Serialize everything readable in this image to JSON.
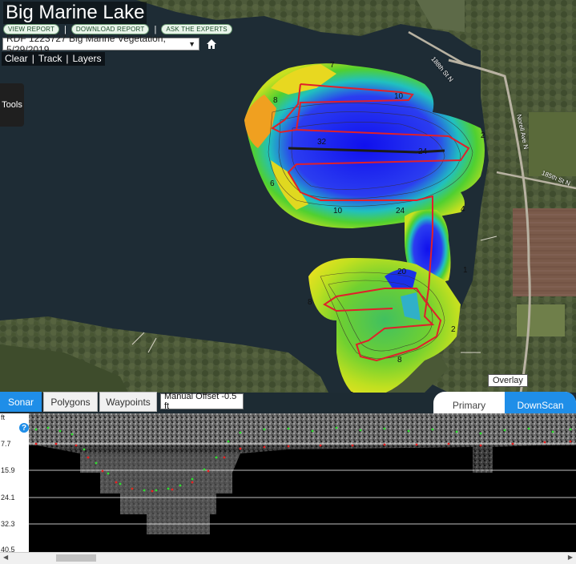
{
  "lake_title": "Big Marine Lake",
  "report_links": [
    "VIEW REPORT",
    "DOWNLOAD REPORT",
    "ASK THE EXPERTS"
  ],
  "link_separator": "|",
  "dataset_select": {
    "value": "RDF 1223727 Big Marine Vegetation, 5/29/2019"
  },
  "map_actions": [
    "Clear",
    "Track",
    "Layers"
  ],
  "tools_label": "Tools",
  "overlay_label": "Overlay",
  "road_labels": [
    "188th St N",
    "Norell Ave N",
    "185th St N"
  ],
  "contour_labels": [
    "7",
    "10",
    "8",
    "32",
    "24",
    "2",
    "6",
    "10",
    "24",
    "4",
    "1",
    "20",
    "8",
    "2",
    "8",
    "6"
  ],
  "bottom_tabs": [
    "Sonar",
    "Polygons",
    "Waypoints"
  ],
  "manual_offset": "Manual Offset -0.5 ft",
  "view_toggle": [
    "Primary",
    "DownScan"
  ],
  "depth_unit": "ft",
  "depth_ticks": [
    "7.7",
    "15.9",
    "24.1",
    "32.3",
    "40.5"
  ],
  "help_icon": "?",
  "colors": {
    "accent": "#1f8ee8",
    "track": "#e0202a",
    "deep": "#1010ee",
    "shallow": "#f0a020"
  }
}
